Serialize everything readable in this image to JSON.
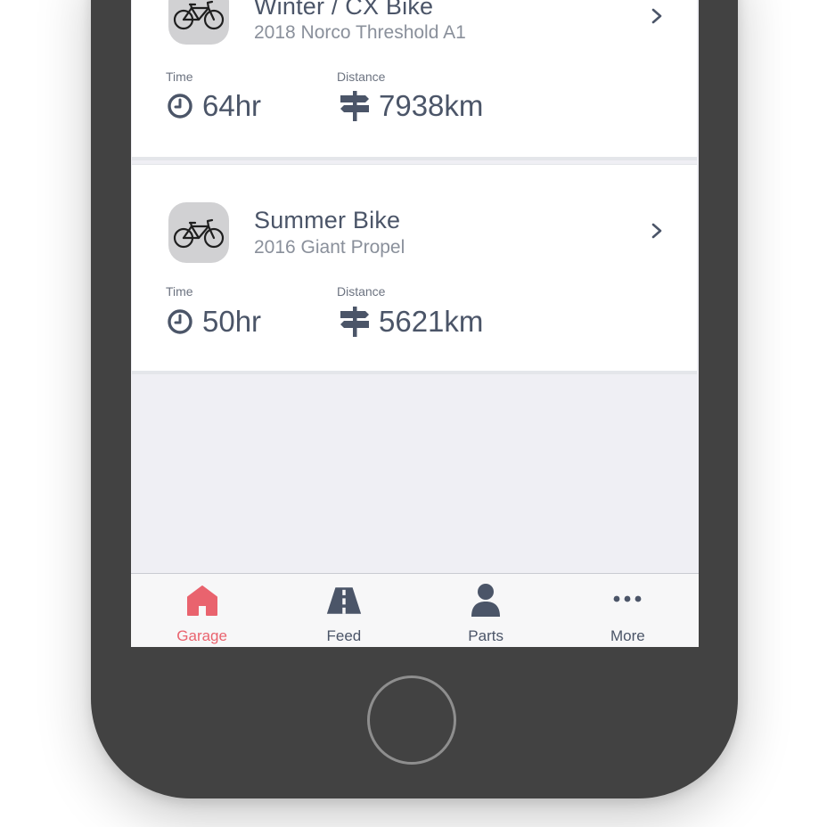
{
  "bikes": [
    {
      "name": "Winter / CX Bike",
      "model": "2018 Norco Threshold A1",
      "time_label": "Time",
      "time_value": "64hr",
      "distance_label": "Distance",
      "distance_value": "7938km",
      "avatar_icon": "bicycle-icon"
    },
    {
      "name": "Summer Bike",
      "model": "2016 Giant Propel",
      "time_label": "Time",
      "time_value": "50hr",
      "distance_label": "Distance",
      "distance_value": "5621km",
      "avatar_icon": "bicycle-icon"
    }
  ],
  "tabbar": {
    "items": [
      {
        "label": "Garage",
        "icon": "house-icon",
        "active": true
      },
      {
        "label": "Feed",
        "icon": "road-icon",
        "active": false
      },
      {
        "label": "Parts",
        "icon": "person-icon",
        "active": false
      },
      {
        "label": "More",
        "icon": "ellipsis-icon",
        "active": false
      }
    ]
  },
  "colors": {
    "accent": "#e9636e",
    "text_primary": "#4b5568",
    "text_secondary": "#8a909b",
    "screen_background": "#efeff4",
    "phone_body": "#424242"
  }
}
